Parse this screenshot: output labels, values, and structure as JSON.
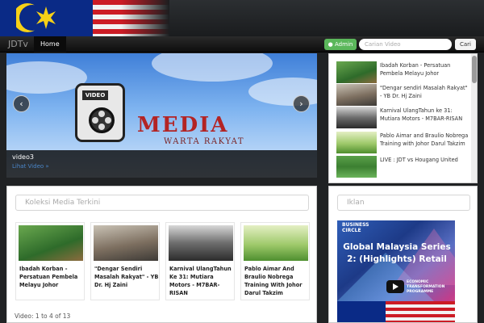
{
  "navbar": {
    "brand": "JDTv",
    "home_label": "Home",
    "admin_label": "Admin",
    "search_placeholder": "Carian Video",
    "search_button": "Cari"
  },
  "slider": {
    "logo_tag": "VIDEO",
    "title": "MEDIA",
    "subtitle": "WARTA RAKYAT",
    "caption_title": "video3",
    "caption_link": "Lihat Video »",
    "prev_icon": "chevron-left-icon",
    "next_icon": "chevron-right-icon"
  },
  "video_list": {
    "items": [
      {
        "label": "Ibadah Korban - Persatuan Pembela Melayu Johor"
      },
      {
        "label": "\"Dengar sendiri Masalah Rakyat\" - YB Dr. Hj Zaini"
      },
      {
        "label": "Karnival UlangTahun ke 31: Mutiara Motors - M7BAR-RISAN"
      },
      {
        "label": "Pablo Aimar and Braulio Nobrega Training with Johor Darul Takzim"
      },
      {
        "label": "LIVE : JDT vs Hougang United"
      }
    ]
  },
  "media_panel": {
    "title": "Koleksi Media Terkini",
    "cards": [
      {
        "label": "Ibadah Korban - Persatuan Pembela Melayu Johor"
      },
      {
        "label": "\"Dengar Sendiri Masalah Rakyat\" - YB Dr. Hj Zaini"
      },
      {
        "label": "Karnival UlangTahun Ke 31: Mutiara Motors - M7BAR-RISAN"
      },
      {
        "label": "Pablo Aimar And Braulio Nobrega Training With Johor Darul Takzim"
      }
    ],
    "count_text": "Video: 1 to 4 of 13"
  },
  "ads_panel": {
    "title": "Iklan",
    "ad_business": "BUSINESS\nCIRCLE",
    "ad_headline": "Global Malaysia Series 2: (Highlights) Retail",
    "ad_etp": "ECONOMIC TRANSFORMATION PROGRAMME"
  },
  "colors": {
    "admin_green": "#5bb75b",
    "slider_title_red": "#b32424",
    "link_blue": "#4a86c9"
  }
}
